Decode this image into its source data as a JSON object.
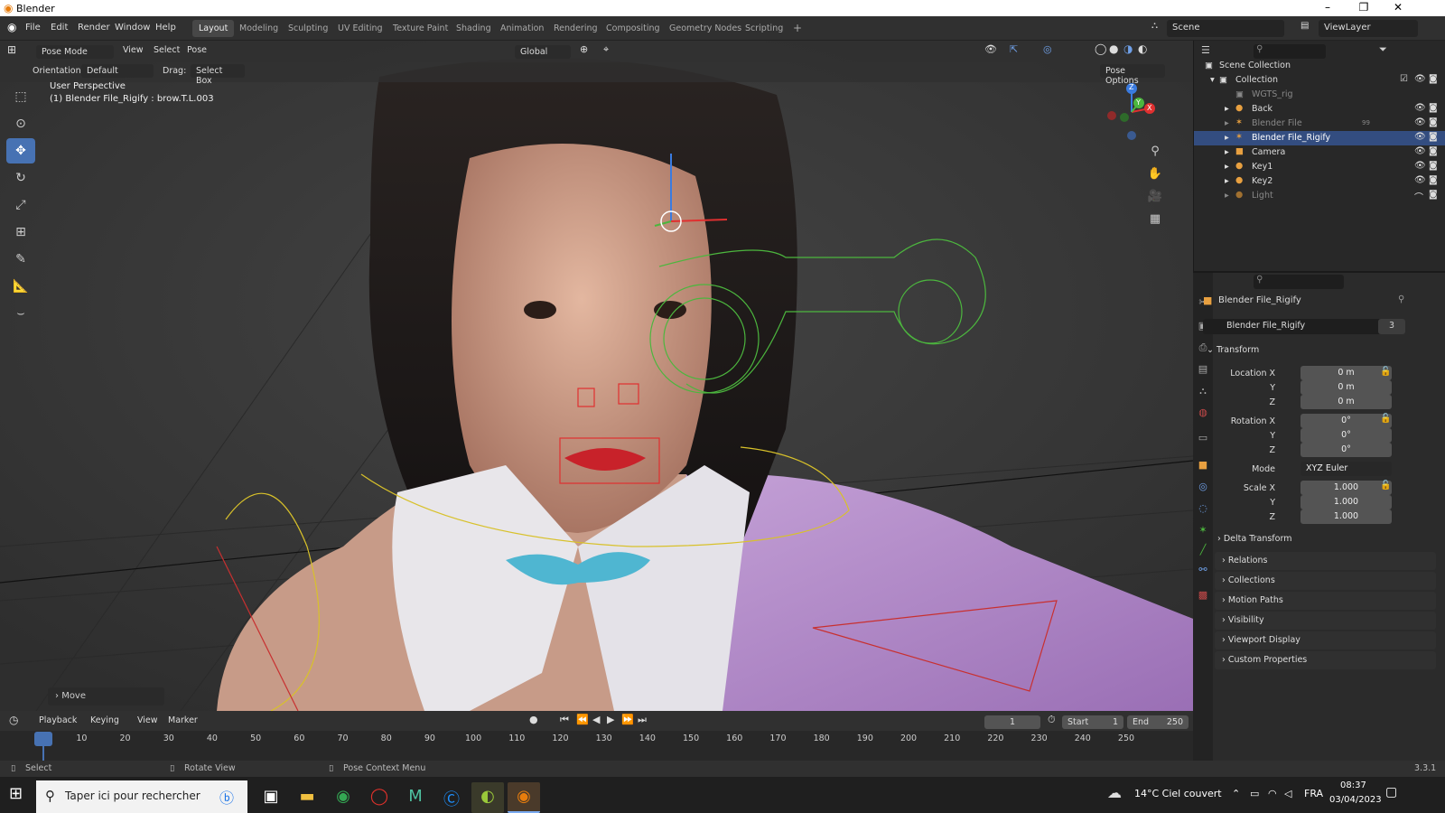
{
  "window": {
    "title": "Blender",
    "minimize": "–",
    "maximize": "❐",
    "close": "✕"
  },
  "menus": [
    "File",
    "Edit",
    "Render",
    "Window",
    "Help"
  ],
  "workspaces": [
    "Layout",
    "Modeling",
    "Sculpting",
    "UV Editing",
    "Texture Paint",
    "Shading",
    "Animation",
    "Rendering",
    "Compositing",
    "Geometry Nodes",
    "Scripting"
  ],
  "add_workspace": "+",
  "scene": {
    "name": "Scene",
    "view_layer": "ViewLayer"
  },
  "viewport": {
    "mode": "Pose Mode",
    "menus": [
      "View",
      "Select",
      "Pose"
    ],
    "transform_orientation": "Global",
    "orientation_label": "Orientation:",
    "orientation_value": "Default",
    "drag_label": "Drag:",
    "drag_value": "Select Box",
    "pose_options": "Pose Options",
    "overlay_title": "User Perspective",
    "overlay_sub": "(1) Blender File_Rigify : brow.T.L.003",
    "operator_panel": "Move",
    "gizmo_axes": {
      "z": "Z",
      "y": "Y",
      "x": "X"
    }
  },
  "outliner": {
    "root": "Scene Collection",
    "collection": "Collection",
    "items": [
      {
        "name": "WGTS_rig",
        "dim": true
      },
      {
        "name": "Back",
        "dim": false
      },
      {
        "name": "Blender File",
        "dim": true,
        "badge": "99"
      },
      {
        "name": "Blender File_Rigify",
        "dim": false,
        "selected": true
      },
      {
        "name": "Camera",
        "dim": false
      },
      {
        "name": "Key1",
        "dim": false
      },
      {
        "name": "Key2",
        "dim": false
      },
      {
        "name": "Light",
        "dim": true
      }
    ]
  },
  "properties": {
    "object_name": "Blender File_Rigify",
    "data_name": "Blender File_Rigify",
    "users": "3",
    "transform_header": "Transform",
    "location_label": "Location X",
    "location": [
      "0 m",
      "0 m",
      "0 m"
    ],
    "rotation_label": "Rotation X",
    "rotation": [
      "0°",
      "0°",
      "0°"
    ],
    "axis_y": "Y",
    "axis_z": "Z",
    "mode_label": "Mode",
    "mode_value": "XYZ Euler",
    "scale_label": "Scale X",
    "scale": [
      "1.000",
      "1.000",
      "1.000"
    ],
    "delta_transform": "Delta Transform",
    "panels": [
      "Relations",
      "Collections",
      "Motion Paths",
      "Visibility",
      "Viewport Display",
      "Custom Properties"
    ]
  },
  "timeline": {
    "menus": [
      "Playback",
      "Keying",
      "View",
      "Marker"
    ],
    "current_frame": "1",
    "start_label": "Start",
    "start": "1",
    "end_label": "End",
    "end": "250",
    "ticks": [
      "1",
      "10",
      "20",
      "30",
      "40",
      "50",
      "60",
      "70",
      "80",
      "90",
      "100",
      "110",
      "120",
      "130",
      "140",
      "150",
      "160",
      "170",
      "180",
      "190",
      "200",
      "210",
      "220",
      "230",
      "240",
      "250"
    ]
  },
  "statusbar": {
    "select": "Select",
    "rotate": "Rotate View",
    "context": "Pose Context Menu",
    "version": "3.3.1"
  },
  "taskbar": {
    "search_placeholder": "Taper ici pour rechercher",
    "weather": "14°C Ciel couvert",
    "language": "FRA",
    "time": "08:37",
    "date": "03/04/2023"
  },
  "colors": {
    "accent": "#4772b3",
    "selected_row": "#334d80",
    "active_frame": "#4772b3"
  }
}
